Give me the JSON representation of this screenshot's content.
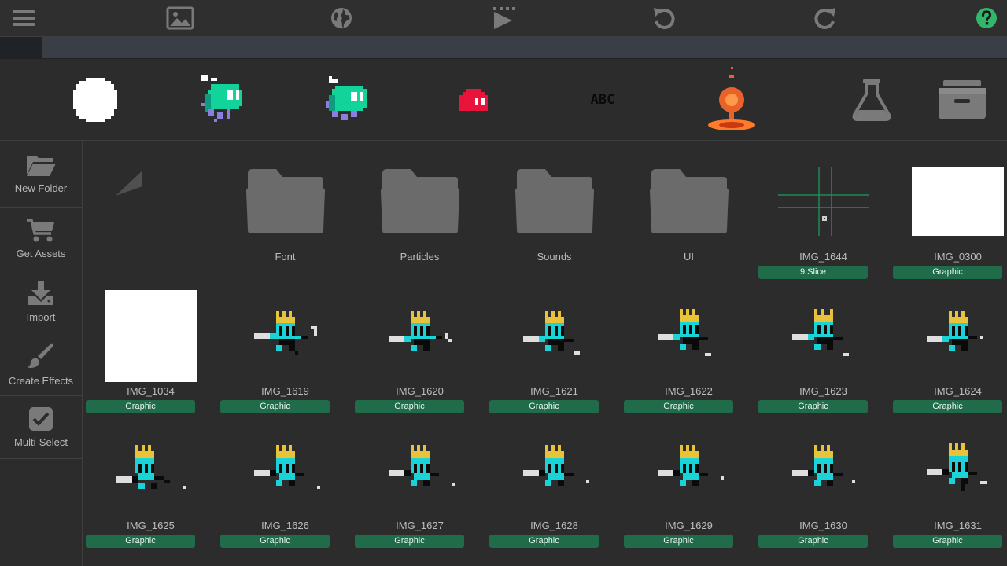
{
  "toolbar": {
    "icons": [
      "menu-icon",
      "image-icon",
      "globe-icon",
      "play-icon",
      "undo-icon",
      "redo-icon",
      "help-icon"
    ],
    "accent": "#2fb86a"
  },
  "object_bar": {
    "items": [
      "white-circle-object",
      "green-ghost-object",
      "green-ghost-object-2",
      "red-slime-object",
      "abc-text-object",
      "orange-pin-object"
    ],
    "abc_text": "ABC",
    "tools": [
      "flask-icon",
      "archive-icon"
    ]
  },
  "sidebar": {
    "items": [
      {
        "label": "New Folder",
        "icon": "folder-open-icon"
      },
      {
        "label": "Get Assets",
        "icon": "cart-icon"
      },
      {
        "label": "Import",
        "icon": "download-icon"
      },
      {
        "label": "Create Effects",
        "icon": "brush-icon"
      },
      {
        "label": "Multi-Select",
        "icon": "checkbox-icon"
      }
    ]
  },
  "colors": {
    "badge": "#1f6b4a",
    "background": "#2c2c2c",
    "folder": "#6b6b6b",
    "knight_teal": "#19d3d6",
    "knight_gold": "#e8c33a"
  },
  "grid": {
    "items": [
      {
        "type": "back",
        "name": "",
        "badge": ""
      },
      {
        "type": "folder",
        "name": "Font",
        "badge": ""
      },
      {
        "type": "folder",
        "name": "Particles",
        "badge": ""
      },
      {
        "type": "folder",
        "name": "Sounds",
        "badge": ""
      },
      {
        "type": "folder",
        "name": "UI",
        "badge": ""
      },
      {
        "type": "slice",
        "name": "IMG_1644",
        "badge": "9 Slice"
      },
      {
        "type": "white",
        "name": "IMG_0300",
        "badge": "Graphic"
      },
      {
        "type": "white",
        "name": "IMG_1034",
        "badge": "Graphic"
      },
      {
        "type": "knight",
        "name": "IMG_1619",
        "badge": "Graphic"
      },
      {
        "type": "knight",
        "name": "IMG_1620",
        "badge": "Graphic"
      },
      {
        "type": "knight",
        "name": "IMG_1621",
        "badge": "Graphic"
      },
      {
        "type": "knight",
        "name": "IMG_1622",
        "badge": "Graphic"
      },
      {
        "type": "knight",
        "name": "IMG_1623",
        "badge": "Graphic"
      },
      {
        "type": "knight",
        "name": "IMG_1624",
        "badge": "Graphic"
      },
      {
        "type": "knight",
        "name": "IMG_1625",
        "badge": "Graphic"
      },
      {
        "type": "knight",
        "name": "IMG_1626",
        "badge": "Graphic"
      },
      {
        "type": "knight",
        "name": "IMG_1627",
        "badge": "Graphic"
      },
      {
        "type": "knight",
        "name": "IMG_1628",
        "badge": "Graphic"
      },
      {
        "type": "knight",
        "name": "IMG_1629",
        "badge": "Graphic"
      },
      {
        "type": "knight",
        "name": "IMG_1630",
        "badge": "Graphic"
      },
      {
        "type": "knight",
        "name": "IMG_1631",
        "badge": "Graphic"
      }
    ]
  }
}
